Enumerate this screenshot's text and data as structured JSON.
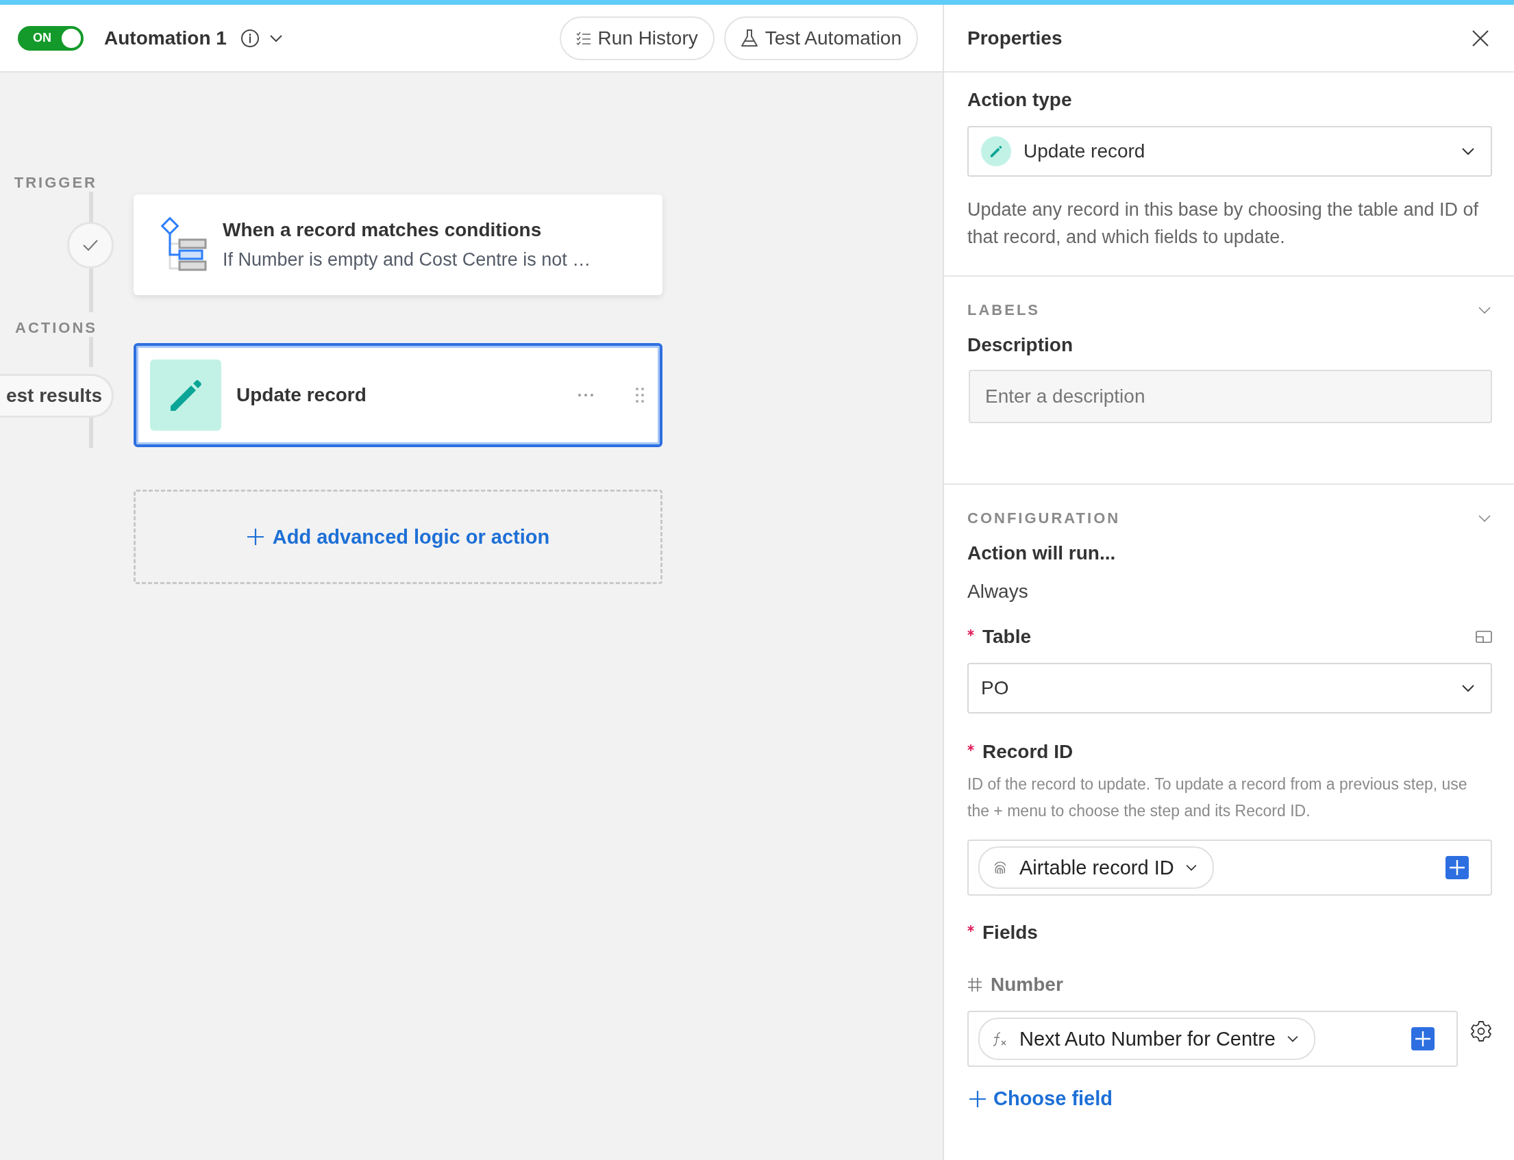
{
  "header": {
    "toggle": {
      "label": "ON",
      "on": true
    },
    "title": "Automation 1",
    "buttons": [
      {
        "label": "Run History",
        "kind": "history"
      },
      {
        "label": "Test Automation",
        "kind": "test"
      }
    ]
  },
  "canvas": {
    "trigger_label": "TRIGGER",
    "trigger_completed": true,
    "trigger": {
      "title": "When a record matches conditions",
      "summary": "If Number is empty and Cost Centre is not …"
    },
    "actions_label": "ACTIONS",
    "test_results_button": "est results",
    "actions": [
      {
        "title": "Update record",
        "selected": true
      }
    ],
    "add_button": "Add advanced logic or action"
  },
  "properties": {
    "title": "Properties",
    "action_type": {
      "label": "Action type",
      "value": "Update record"
    },
    "description": "Update any record in this base by choosing the table and ID of that record, and which fields to update.",
    "labels_section": {
      "heading": "LABELS",
      "expanded": true,
      "description_field": {
        "label": "Description",
        "placeholder": "Enter a description"
      }
    },
    "configuration": {
      "heading": "CONFIGURATION",
      "expanded": true,
      "run_condition_label": "Action will run...",
      "run_condition": "Always",
      "table": {
        "label": "Table",
        "required": true,
        "value": "PO"
      },
      "record_id": {
        "label": "Record ID",
        "required": true,
        "help": "ID of the record to update. To update a record from a previous step, use the + menu to choose the step and its Record ID.",
        "token": "Airtable record ID"
      },
      "fields": {
        "label": "Fields",
        "required": true,
        "items": [
          {
            "name": "Number",
            "token": "Next Auto Number for Centre"
          }
        ],
        "add_label": "Choose field"
      }
    }
  }
}
